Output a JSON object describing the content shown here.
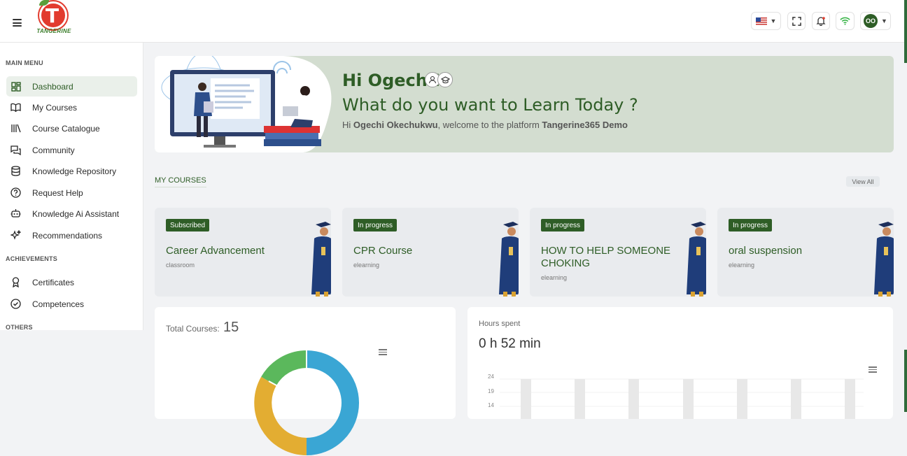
{
  "header": {
    "logo_text": "TANGERINE",
    "language": "US",
    "user_initials": "OO"
  },
  "sidebar": {
    "sections": [
      {
        "label": "MAIN MENU"
      },
      {
        "label": "ACHIEVEMENTS"
      },
      {
        "label": "OTHERS"
      }
    ],
    "items": [
      {
        "label": "Dashboard",
        "icon": "dashboard-icon",
        "active": true
      },
      {
        "label": "My Courses",
        "icon": "book-icon"
      },
      {
        "label": "Course Catalogue",
        "icon": "library-icon"
      },
      {
        "label": "Community",
        "icon": "chat-icon"
      },
      {
        "label": "Knowledge Repository",
        "icon": "database-icon"
      },
      {
        "label": "Request Help",
        "icon": "help-icon"
      },
      {
        "label": "Knowledge Ai Assistant",
        "icon": "bot-icon"
      },
      {
        "label": "Recommendations",
        "icon": "sparkle-icon"
      },
      {
        "label": "Certificates",
        "icon": "award-icon"
      },
      {
        "label": "Competences",
        "icon": "check-circle-icon"
      }
    ]
  },
  "banner": {
    "greeting": "Hi Ogechi!",
    "question": "What do you want to Learn Today ?",
    "welcome_prefix": "Hi ",
    "user_name": "Ogechi Okechukwu",
    "welcome_middle": ", welcome to the platform ",
    "platform": "Tangerine365 Demo"
  },
  "my_courses": {
    "title": "MY COURSES",
    "view_all": "View All",
    "cards": [
      {
        "status": "Subscribed",
        "name": "Career Advancement",
        "type": "classroom"
      },
      {
        "status": "In progress",
        "name": "CPR Course",
        "type": "elearning"
      },
      {
        "status": "In progress",
        "name": "HOW TO HELP SOMEONE CHOKING",
        "type": "elearning"
      },
      {
        "status": "In progress",
        "name": "oral suspension",
        "type": "elearning"
      }
    ]
  },
  "stats": {
    "total_courses_label": "Total Courses:",
    "total_courses_value": "15",
    "hours_label": "Hours spent",
    "hours_value": "0 h 52 min",
    "y_ticks": [
      "24",
      "19",
      "14"
    ]
  },
  "colors": {
    "brand_green": "#2e5d26",
    "donut_blue": "#3aa6d4",
    "donut_yellow": "#e3ad32",
    "donut_green": "#5bb85c"
  }
}
